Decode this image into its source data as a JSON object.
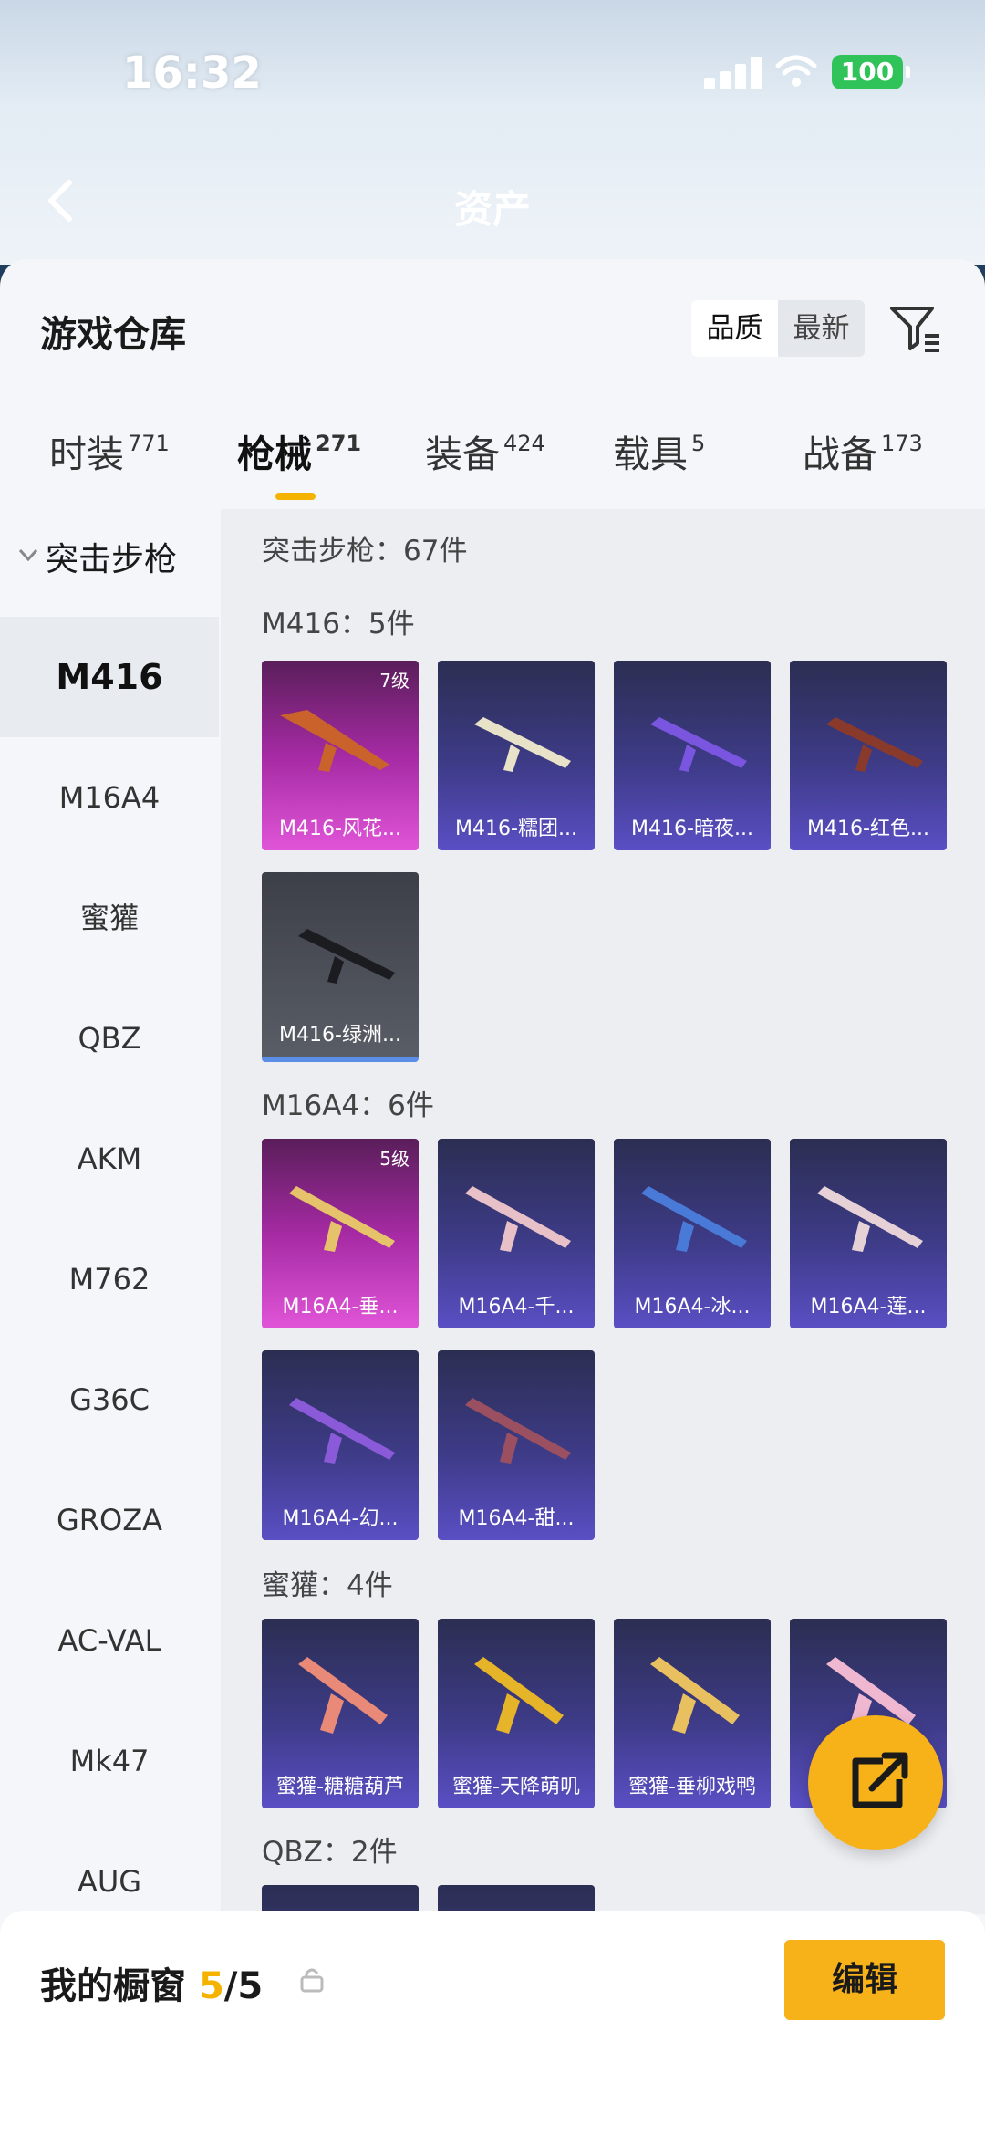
{
  "status_bar": {
    "time": "16:32",
    "battery": "100"
  },
  "nav": {
    "title": "资产"
  },
  "sheet": {
    "title": "游戏仓库"
  },
  "sort": {
    "quality": "品质",
    "latest": "最新"
  },
  "tabs": [
    {
      "label": "时装",
      "count": "771"
    },
    {
      "label": "枪械",
      "count": "271"
    },
    {
      "label": "装备",
      "count": "424"
    },
    {
      "label": "载具",
      "count": "5"
    },
    {
      "label": "战备",
      "count": "173"
    }
  ],
  "categories": {
    "group": "突击步枪",
    "items": [
      "M416",
      "M16A4",
      "蜜獾",
      "QBZ",
      "AKM",
      "M762",
      "G36C",
      "GROZA",
      "AC-VAL",
      "Mk47",
      "AUG"
    ]
  },
  "content": {
    "total": "突击步枪：67件",
    "sections": [
      {
        "label": "M416：5件",
        "cards": [
          {
            "name": "M416-风花...",
            "level": "7级",
            "style": "pink"
          },
          {
            "name": "M416-糯团...",
            "level": "",
            "style": "purple"
          },
          {
            "name": "M416-暗夜...",
            "level": "",
            "style": "purple"
          },
          {
            "name": "M416-红色...",
            "level": "",
            "style": "purple"
          },
          {
            "name": "M416-绿洲...",
            "level": "",
            "style": "grey"
          }
        ]
      },
      {
        "label": "M16A4：6件",
        "cards": [
          {
            "name": "M16A4-垂...",
            "level": "5级",
            "style": "pink"
          },
          {
            "name": "M16A4-千...",
            "level": "",
            "style": "purple"
          },
          {
            "name": "M16A4-冰...",
            "level": "",
            "style": "purple"
          },
          {
            "name": "M16A4-莲...",
            "level": "",
            "style": "purple"
          },
          {
            "name": "M16A4-幻...",
            "level": "",
            "style": "purple"
          },
          {
            "name": "M16A4-甜...",
            "level": "",
            "style": "purple"
          }
        ]
      },
      {
        "label": "蜜獾：4件",
        "cards": [
          {
            "name": "蜜獾-糖糖葫芦",
            "level": "",
            "style": "purple"
          },
          {
            "name": "蜜獾-天降萌叽",
            "level": "",
            "style": "purple"
          },
          {
            "name": "蜜獾-垂柳戏鸭",
            "level": "",
            "style": "purple"
          },
          {
            "name": "",
            "level": "",
            "style": "purple"
          }
        ]
      },
      {
        "label": "QBZ：2件",
        "cards": []
      }
    ]
  },
  "showcase": {
    "label": "我的橱窗",
    "used": "5",
    "total": "/5"
  },
  "edit_label": "编辑",
  "colors": {
    "accent": "#f7b21a",
    "tab_indicator": "#f5b300"
  },
  "icons": [
    "back-icon",
    "filter-icon",
    "share-icon",
    "lock-icon",
    "chevron-down-icon"
  ]
}
